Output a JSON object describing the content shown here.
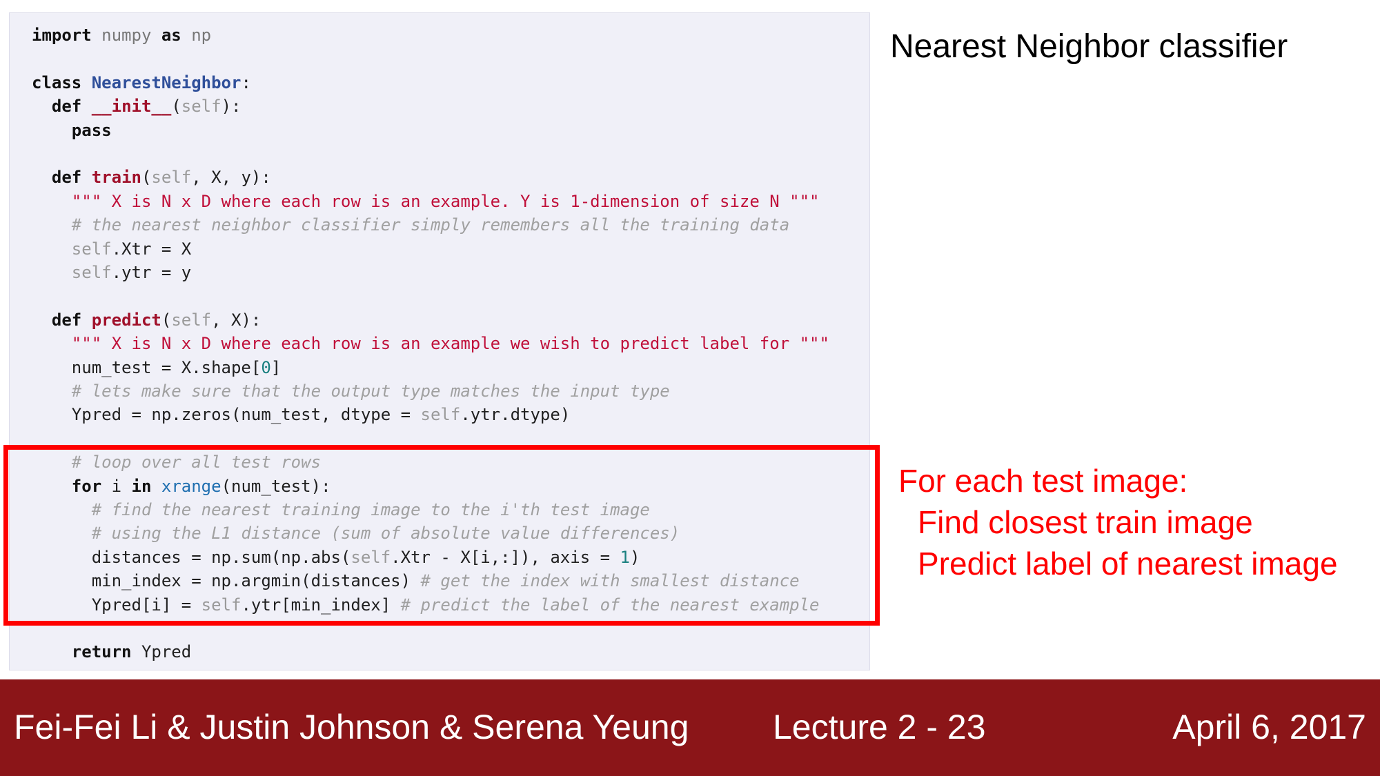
{
  "slide": {
    "title": "Nearest Neighbor classifier",
    "annotation": [
      "For each test image:",
      "Find closest train image",
      "Predict label of nearest image"
    ]
  },
  "code": {
    "lines": [
      [
        {
          "t": "import",
          "c": "kw"
        },
        {
          "t": " "
        },
        {
          "t": "numpy",
          "c": "mod"
        },
        {
          "t": " "
        },
        {
          "t": "as",
          "c": "kw"
        },
        {
          "t": " "
        },
        {
          "t": "np",
          "c": "mod"
        }
      ],
      [],
      [
        {
          "t": "class",
          "c": "kw"
        },
        {
          "t": " "
        },
        {
          "t": "NearestNeighbor",
          "c": "cls"
        },
        {
          "t": ":"
        }
      ],
      [
        {
          "t": "  "
        },
        {
          "t": "def",
          "c": "kw"
        },
        {
          "t": " "
        },
        {
          "t": "__init__",
          "c": "fn"
        },
        {
          "t": "("
        },
        {
          "t": "self",
          "c": "self"
        },
        {
          "t": "):"
        }
      ],
      [
        {
          "t": "    "
        },
        {
          "t": "pass",
          "c": "kw"
        }
      ],
      [],
      [
        {
          "t": "  "
        },
        {
          "t": "def",
          "c": "kw"
        },
        {
          "t": " "
        },
        {
          "t": "train",
          "c": "fn"
        },
        {
          "t": "("
        },
        {
          "t": "self",
          "c": "self"
        },
        {
          "t": ", X, y):"
        }
      ],
      [
        {
          "t": "    "
        },
        {
          "t": "\"\"\" X is N x D where each row is an example. Y is 1-dimension of size N \"\"\"",
          "c": "str"
        }
      ],
      [
        {
          "t": "    "
        },
        {
          "t": "# the nearest neighbor classifier simply remembers all the training data",
          "c": "com"
        }
      ],
      [
        {
          "t": "    "
        },
        {
          "t": "self",
          "c": "self"
        },
        {
          "t": ".Xtr = X"
        }
      ],
      [
        {
          "t": "    "
        },
        {
          "t": "self",
          "c": "self"
        },
        {
          "t": ".ytr = y"
        }
      ],
      [],
      [
        {
          "t": "  "
        },
        {
          "t": "def",
          "c": "kw"
        },
        {
          "t": " "
        },
        {
          "t": "predict",
          "c": "fn"
        },
        {
          "t": "("
        },
        {
          "t": "self",
          "c": "self"
        },
        {
          "t": ", X):"
        }
      ],
      [
        {
          "t": "    "
        },
        {
          "t": "\"\"\" X is N x D where each row is an example we wish to predict label for \"\"\"",
          "c": "str"
        }
      ],
      [
        {
          "t": "    num_test = X.shape["
        },
        {
          "t": "0",
          "c": "num"
        },
        {
          "t": "]"
        }
      ],
      [
        {
          "t": "    "
        },
        {
          "t": "# lets make sure that the output type matches the input type",
          "c": "com"
        }
      ],
      [
        {
          "t": "    Ypred = np.zeros(num_test, dtype = "
        },
        {
          "t": "self",
          "c": "self"
        },
        {
          "t": ".ytr.dtype)"
        }
      ],
      [],
      [
        {
          "t": "    "
        },
        {
          "t": "# loop over all test rows",
          "c": "com"
        }
      ],
      [
        {
          "t": "    "
        },
        {
          "t": "for",
          "c": "kw"
        },
        {
          "t": " i "
        },
        {
          "t": "in",
          "c": "kw"
        },
        {
          "t": " "
        },
        {
          "t": "xrange",
          "c": "bi"
        },
        {
          "t": "(num_test):"
        }
      ],
      [
        {
          "t": "      "
        },
        {
          "t": "# find the nearest training image to the i'th test image",
          "c": "com"
        }
      ],
      [
        {
          "t": "      "
        },
        {
          "t": "# using the L1 distance (sum of absolute value differences)",
          "c": "com"
        }
      ],
      [
        {
          "t": "      distances = np.sum(np.abs("
        },
        {
          "t": "self",
          "c": "self"
        },
        {
          "t": ".Xtr - X[i,:]), axis = "
        },
        {
          "t": "1",
          "c": "num"
        },
        {
          "t": ")"
        }
      ],
      [
        {
          "t": "      min_index = np.argmin(distances) "
        },
        {
          "t": "# get the index with smallest distance",
          "c": "com"
        }
      ],
      [
        {
          "t": "      Ypred[i] = "
        },
        {
          "t": "self",
          "c": "self"
        },
        {
          "t": ".ytr[min_index] "
        },
        {
          "t": "# predict the label of the nearest example",
          "c": "com"
        }
      ],
      [],
      [
        {
          "t": "    "
        },
        {
          "t": "return",
          "c": "kw"
        },
        {
          "t": " Ypred"
        }
      ]
    ]
  },
  "footer": {
    "authors": "Fei-Fei Li & Justin Johnson & Serena Yeung",
    "lecture": "Lecture 2 -   23",
    "date": "April 6, 2017"
  }
}
